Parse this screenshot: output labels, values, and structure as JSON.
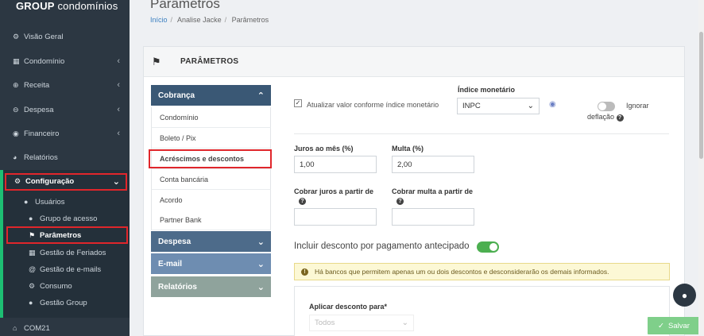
{
  "brand": {
    "bold": "GROUP",
    "rest": " condomínios"
  },
  "sidebar": {
    "items": [
      {
        "label": "Visão Geral",
        "icon": "⚙"
      },
      {
        "label": "Condomínio",
        "icon": "▦"
      },
      {
        "label": "Receita",
        "icon": "●"
      },
      {
        "label": "Despesa",
        "icon": "●"
      },
      {
        "label": "Financeiro",
        "icon": "●"
      },
      {
        "label": "Relatórios",
        "icon": "●"
      },
      {
        "label": "Configuração",
        "icon": "⚙"
      }
    ],
    "sub": [
      {
        "label": "Usuários"
      },
      {
        "label": "Grupo de acesso"
      },
      {
        "label": "Parâmetros"
      },
      {
        "label": "Gestão de Feriados"
      },
      {
        "label": "Gestão de e-mails"
      },
      {
        "label": "Consumo"
      },
      {
        "label": "Gestão Group"
      }
    ],
    "bottom": {
      "label": "COM21"
    }
  },
  "header": {
    "title": "Parâmetros",
    "breadcrumb": [
      "Início",
      "Analise Jacke",
      "Parâmetros"
    ]
  },
  "card": {
    "title": "PARÂMETROS"
  },
  "left_menu": {
    "cobranca": "Cobrança",
    "items": [
      "Condomínio",
      "Boleto / Pix",
      "Acréscimos e descontos",
      "Conta bancária",
      "Acordo",
      "Partner Bank"
    ],
    "despesa": "Despesa",
    "email": "E-mail",
    "relatorios": "Relatórios"
  },
  "form": {
    "atualizar_label": "Atualizar valor conforme índice monetário",
    "indice_label": "Índice monetário",
    "indice_value": "INPC",
    "ignorar_label": "Ignorar",
    "deflacao_label": "deflação",
    "juros_label": "Juros ao mês (%)",
    "juros_value": "1,00",
    "multa_label": "Multa (%)",
    "multa_value": "2,00",
    "cobrar_juros_label": "Cobrar juros a partir de",
    "cobrar_multa_label": "Cobrar multa a partir de",
    "desconto_label": "Incluir desconto por pagamento antecipado",
    "alert_text": "Há bancos que permitem apenas um ou dois descontos e desconsiderarão os demais informados.",
    "aplicar_label": "Aplicar desconto para*",
    "aplicar_value": "Todos"
  },
  "save_label": "Salvar",
  "colors": {
    "sidebar": "#2c3742",
    "accent_green": "#1dbf73",
    "cobranca": "#3a5875",
    "despesa": "#4d6b8a",
    "email": "#6e8db1",
    "relatorios": "#8fa39c",
    "highlight": "#e0262b"
  }
}
